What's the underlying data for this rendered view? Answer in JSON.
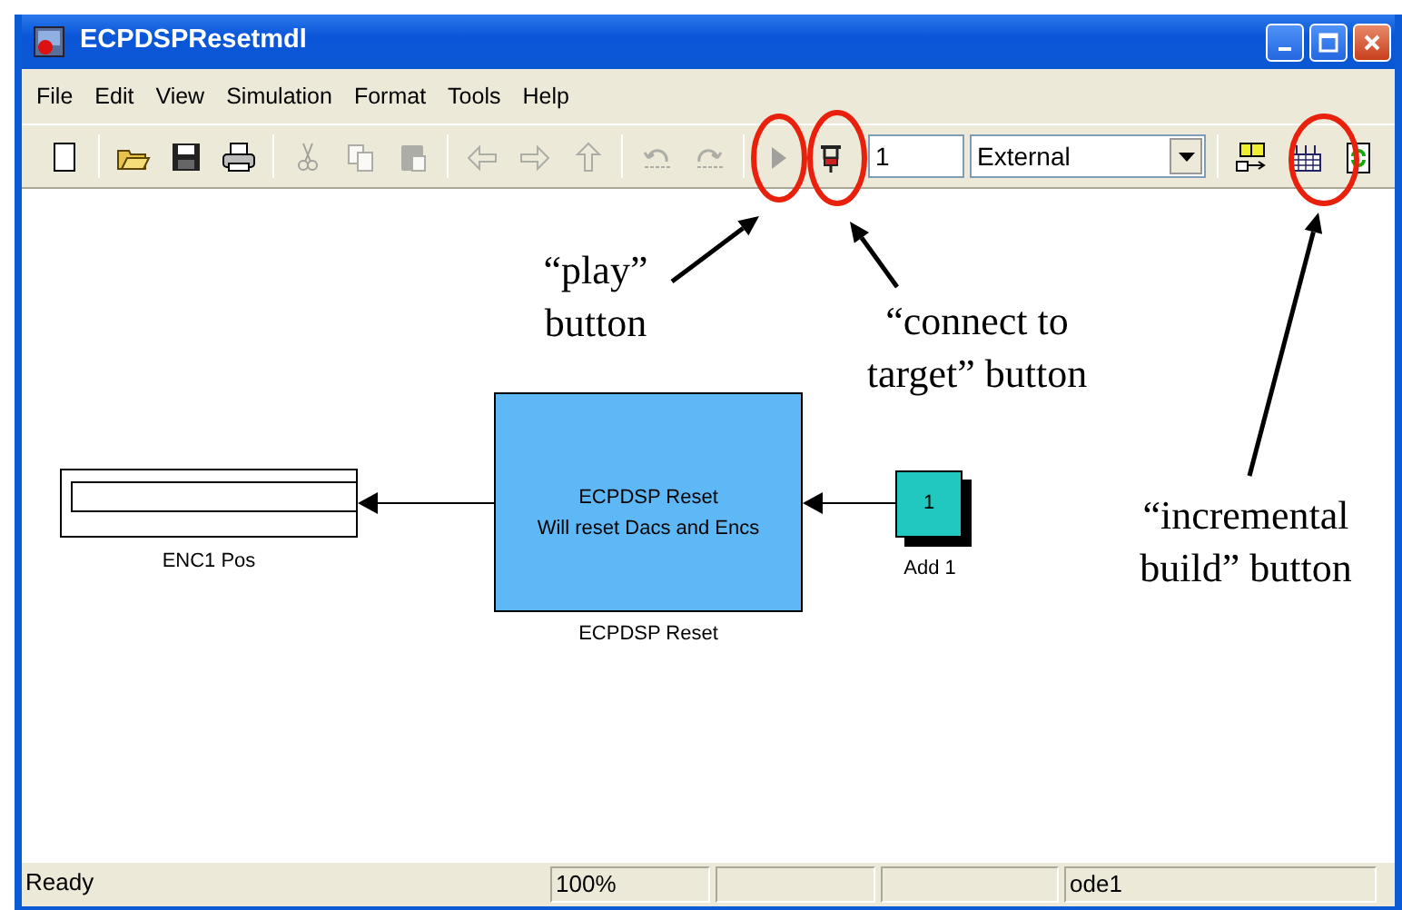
{
  "window": {
    "title": "ECPDSPResetmdl"
  },
  "menu": [
    "File",
    "Edit",
    "View",
    "Simulation",
    "Format",
    "Tools",
    "Help"
  ],
  "toolbar": [
    {
      "kind": "new",
      "disabled": false
    },
    {
      "kind": "separator"
    },
    {
      "kind": "open",
      "disabled": false
    },
    {
      "kind": "save",
      "disabled": false
    },
    {
      "kind": "print",
      "disabled": false
    },
    {
      "kind": "separator"
    },
    {
      "kind": "cut",
      "disabled": true
    },
    {
      "kind": "copy",
      "disabled": true
    },
    {
      "kind": "paste",
      "disabled": true
    },
    {
      "kind": "separator"
    },
    {
      "kind": "back",
      "disabled": true
    },
    {
      "kind": "forward",
      "disabled": true
    },
    {
      "kind": "up",
      "disabled": true
    },
    {
      "kind": "separator"
    },
    {
      "kind": "undo",
      "disabled": true
    },
    {
      "kind": "redo",
      "disabled": true
    },
    {
      "kind": "separator"
    },
    {
      "kind": "play",
      "disabled": true
    },
    {
      "kind": "connect",
      "disabled": false
    },
    {
      "kind": "stop_time",
      "value": "1"
    },
    {
      "kind": "mode",
      "value": "External"
    },
    {
      "kind": "separator"
    },
    {
      "kind": "browser",
      "disabled": false
    },
    {
      "kind": "build",
      "disabled": false
    },
    {
      "kind": "refresh",
      "disabled": false
    }
  ],
  "diagram": {
    "blocks": [
      {
        "kind": "display",
        "label": "ENC1 Pos"
      },
      {
        "kind": "subsystem",
        "lines": [
          "ECPDSP Reset",
          "Will reset Dacs and Encs"
        ],
        "label": "ECPDSP Reset"
      },
      {
        "kind": "constant",
        "value": "1",
        "label": "Add 1"
      }
    ]
  },
  "status_bar": {
    "message": "Ready",
    "zoom": "100%",
    "solver": "ode1"
  },
  "annotations": [
    {
      "text": "“play”\nbutton"
    },
    {
      "text": "“connect to\ntarget” button"
    },
    {
      "text": "“incremental\nbuild” button"
    }
  ]
}
